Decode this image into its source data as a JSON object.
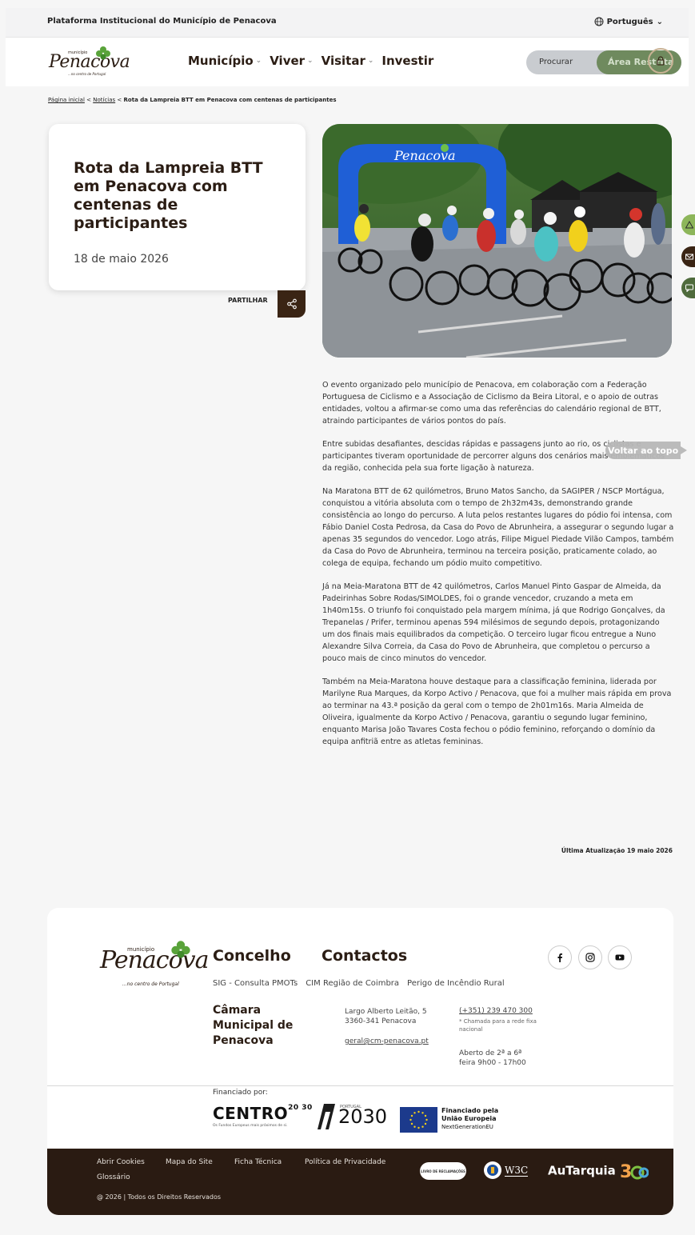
{
  "topbar": {
    "platform": "Plataforma Institucional do Município de Penacova",
    "language": "Português"
  },
  "header": {
    "logo": {
      "small": "município",
      "word": "Penacova",
      "tag": "...no centro de Portugal"
    },
    "nav": [
      {
        "label": "Município",
        "has_dropdown": true
      },
      {
        "label": "Viver",
        "has_dropdown": true
      },
      {
        "label": "Visitar",
        "has_dropdown": true
      },
      {
        "label": "Investir",
        "has_dropdown": false
      }
    ],
    "search_label": "Procurar",
    "restricted_label": "Área Restrita"
  },
  "breadcrumb": {
    "home": "Página inicial",
    "section": "Notícias",
    "current": "Rota da Lampreia BTT em Penacova com centenas de participantes",
    "sep": "<"
  },
  "article": {
    "title": "Rota da Lampreia BTT em Penacova com centenas de participantes",
    "date": "18 de maio 2026",
    "share_label": "PARTILHAR",
    "photo_arch_text": "Penacova",
    "paragraphs": [
      "O evento organizado pelo município de Penacova, em colaboração com a Federação Portuguesa de Ciclismo e a Associação de Ciclismo da Beira Litoral, e o apoio de outras entidades, voltou a afirmar-se como uma das referências do calendário regional de BTT, atraindo participantes de vários pontos do país.",
      "Entre subidas desafiantes, descidas rápidas e passagens junto ao rio, os ciclistas e participantes tiveram oportunidade de percorrer alguns dos cenários mais emblemáticos da região, conhecida pela sua forte ligação à natureza.",
      "Na Maratona BTT de 62 quilómetros, Bruno Matos Sancho, da SAGIPER / NSCP Mortágua, conquistou a vitória absoluta com o tempo de 2h32m43s, demonstrando grande consistência ao longo do percurso. A luta pelos restantes lugares do pódio foi intensa, com Fábio Daniel Costa Pedrosa, da Casa do Povo de Abrunheira, a assegurar o segundo lugar a apenas 35 segundos do vencedor. Logo atrás, Filipe Miguel Piedade Vilão Campos, também da Casa do Povo de Abrunheira, terminou na terceira posição, praticamente colado, ao colega de equipa, fechando um pódio muito competitivo.",
      "Já na Meia-Maratona BTT de 42 quilómetros, Carlos Manuel Pinto Gaspar de Almeida, da Padeirinhas Sobre Rodas/SIMOLDES, foi o grande vencedor, cruzando a meta em 1h40m15s. O triunfo foi conquistado pela margem mínima, já que Rodrigo Gonçalves, da Trepanelas / Prifer, terminou apenas 594 milésimos de segundo depois, protagonizando um dos finais mais equilibrados da competição. O terceiro lugar ficou entregue a Nuno Alexandre Silva Correia, da Casa do Povo de Abrunheira, que completou o percurso a pouco mais de cinco minutos do vencedor.",
      "Também na Meia-Maratona houve destaque para a classificação feminina, liderada por Marilyne Rua Marques, da Korpo Activo / Penacova, que foi a mulher mais rápida em prova ao terminar na 43.ª posição da geral com o tempo de 2h01m16s. Maria Almeida de Oliveira, igualmente da Korpo Activo / Penacova, garantiu o segundo lugar feminino, enquanto Marisa João Tavares Costa fechou o pódio feminino, reforçando o domínio da equipa anfitriã entre as atletas femininas."
    ],
    "updated": "Última Atualização 19 maio 2026",
    "back_to_top": "Voltar ao topo"
  },
  "footer": {
    "logo": {
      "small": "município",
      "word": "Penacova",
      "tag": "...no centro de Portugal"
    },
    "headings": {
      "concelho": "Concelho",
      "contactos": "Contactos"
    },
    "links": [
      "SIG - Consulta PMOTs",
      "CIM Região de Coimbra",
      "Perigo de Incêndio Rural"
    ],
    "camara": "Câmara Municipal de Penacova",
    "address": "Largo Alberto Leitão, 5 3360-341 Penacova",
    "email": "geral@cm-penacova.pt",
    "phone": "(+351) 239 470 300",
    "phone_note": "* Chamada para a rede fixa nacional",
    "hours": "Aberto de 2ª a 6ª feira 9h00 - 17h00",
    "funded_by": "Financiado por:",
    "centro": {
      "big": "CENTRO",
      "suffix": "20 30",
      "mini": "Os Fundos Europeus mais próximos de si."
    },
    "portugal2030": {
      "label": "PORTUGAL",
      "year": "2030"
    },
    "eu": {
      "line1": "Financiado pela",
      "line2": "União Europeia",
      "line3": "NextGenerationEU"
    },
    "bottom_links": [
      "Abrir Cookies",
      "Mapa do Site",
      "Ficha Técnica",
      "Política de Privacidade",
      "Glossário"
    ],
    "copyright": "@ 2026 | Todos os Direitos Reservados",
    "livro": "LIVRO DE RECLAMAÇÕES",
    "w3c": "W3C",
    "autarquia": "AuTarquia"
  },
  "colors": {
    "brand_dark": "#2b1d14",
    "brand_green": "#6f8a5e",
    "arch_blue": "#1f5fd6",
    "footer_dark": "#2a1b12"
  }
}
